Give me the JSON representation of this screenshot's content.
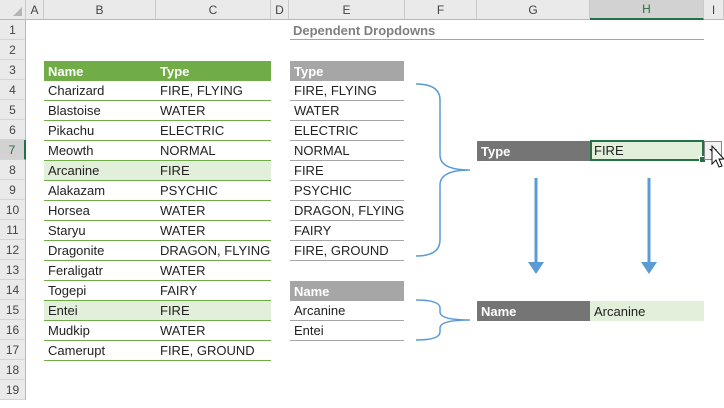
{
  "columns": [
    "A",
    "B",
    "C",
    "D",
    "E",
    "F",
    "G",
    "H",
    "I"
  ],
  "rows": [
    "1",
    "2",
    "3",
    "4",
    "5",
    "6",
    "7",
    "8",
    "9",
    "10",
    "11",
    "12",
    "13",
    "14",
    "15",
    "16",
    "17",
    "18",
    "19"
  ],
  "selected_column": "H",
  "selected_row": "7",
  "title": "Dependent Dropdowns",
  "pokemon_table": {
    "headers": [
      "Name",
      "Type"
    ],
    "rows": [
      {
        "name": "Charizard",
        "type": "FIRE, FLYING"
      },
      {
        "name": "Blastoise",
        "type": "WATER"
      },
      {
        "name": "Pikachu",
        "type": "ELECTRIC"
      },
      {
        "name": "Meowth",
        "type": "NORMAL"
      },
      {
        "name": "Arcanine",
        "type": "FIRE"
      },
      {
        "name": "Alakazam",
        "type": "PSYCHIC"
      },
      {
        "name": "Horsea",
        "type": "WATER"
      },
      {
        "name": "Staryu",
        "type": "WATER"
      },
      {
        "name": "Dragonite",
        "type": "DRAGON, FLYING"
      },
      {
        "name": "Feraligatr",
        "type": "WATER"
      },
      {
        "name": "Togepi",
        "type": "FAIRY"
      },
      {
        "name": "Entei",
        "type": "FIRE"
      },
      {
        "name": "Mudkip",
        "type": "WATER"
      },
      {
        "name": "Camerupt",
        "type": "FIRE, GROUND"
      }
    ]
  },
  "type_list": {
    "header": "Type",
    "items": [
      "FIRE, FLYING",
      "WATER",
      "ELECTRIC",
      "NORMAL",
      "FIRE",
      "PSYCHIC",
      "DRAGON, FLYING",
      "FAIRY",
      "FIRE, GROUND"
    ]
  },
  "name_list": {
    "header": "Name",
    "items": [
      "Arcanine",
      "Entei"
    ]
  },
  "selector": {
    "type_label": "Type",
    "type_value": "FIRE",
    "name_label": "Name",
    "name_value": "Arcanine"
  },
  "colors": {
    "green_header": "#70ad47",
    "highlight": "#e2efda",
    "gray_header": "#a6a6a6",
    "dark_header": "#757575",
    "arrow": "#5b9bd5",
    "brace": "#5b9bd5"
  },
  "icons": [
    "dropdown-arrow-icon",
    "mouse-pointer-icon",
    "down-arrow-icon",
    "brace-icon"
  ]
}
